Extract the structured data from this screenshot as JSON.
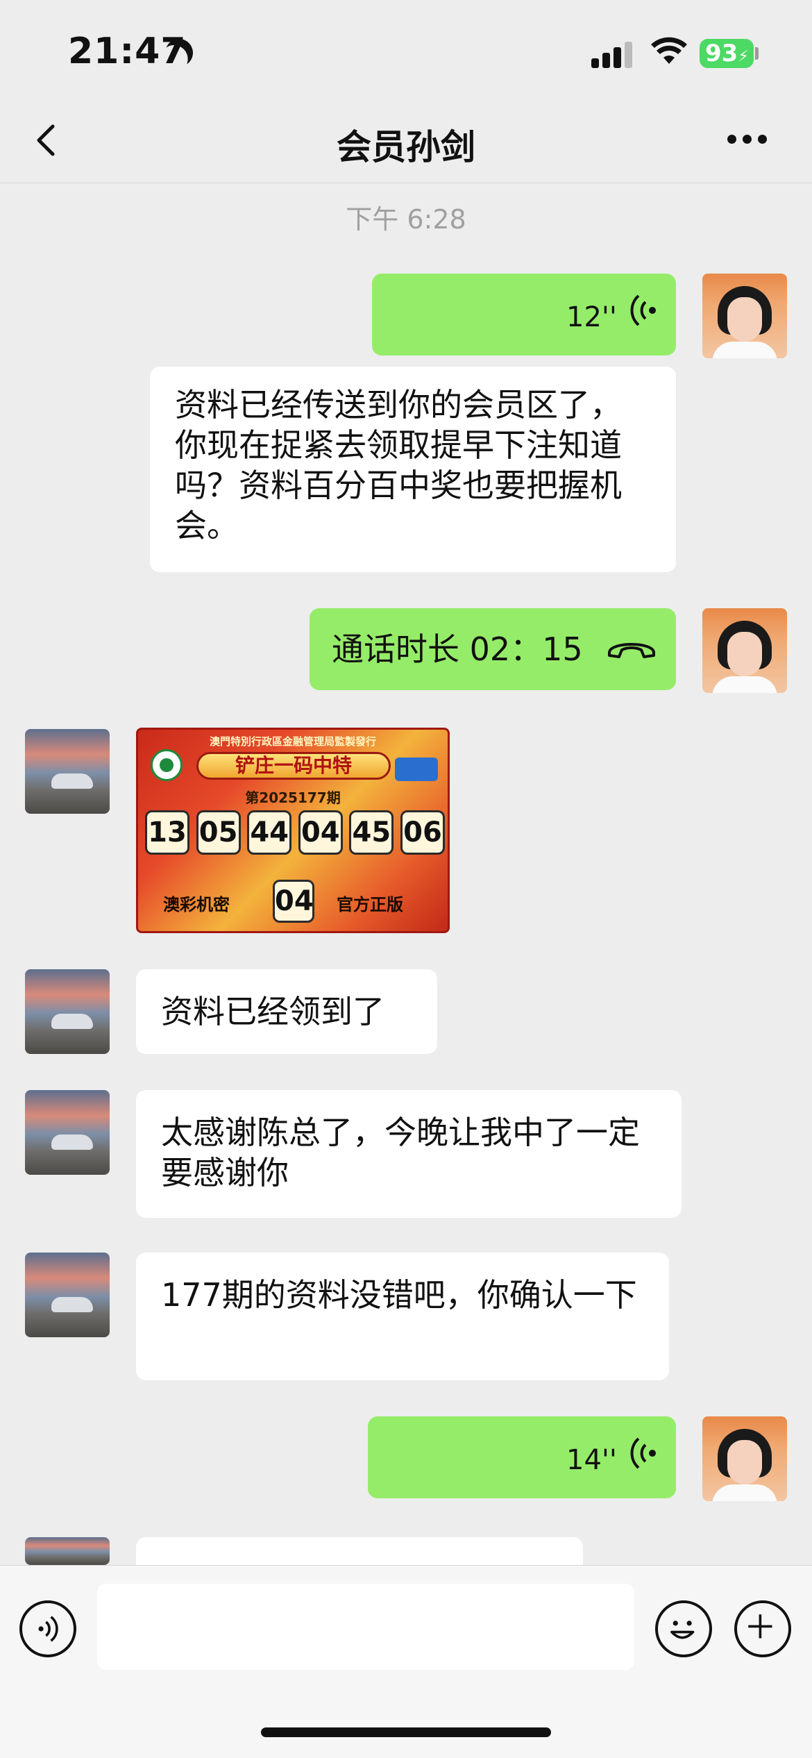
{
  "status_bar": {
    "time": "21:47",
    "battery": "93"
  },
  "nav": {
    "title": "会员孙剑"
  },
  "timestamp": "下午 6:28",
  "messages": [
    {
      "from": "self",
      "type": "voice",
      "duration": "12''"
    },
    {
      "from": "self",
      "type": "text",
      "text": "资料已经传送到你的会员区了，你现在捉紧去领取提早下注知道吗？资料百分百中奖也要把握机会。"
    },
    {
      "from": "self",
      "type": "call",
      "text": "通话时长 02：15"
    },
    {
      "from": "other",
      "type": "image",
      "card": {
        "header": "澳門特別行政區金融管理局監製發行",
        "title": "铲庄一码中特",
        "period": "第2025177期",
        "numbers": [
          "13",
          "05",
          "44",
          "04",
          "45",
          "06"
        ],
        "left_label": "澳彩机密",
        "special": "04",
        "right_label": "官方正版"
      }
    },
    {
      "from": "other",
      "type": "text",
      "text": "资料已经领到了"
    },
    {
      "from": "other",
      "type": "text",
      "text": "太感谢陈总了，今晚让我中了一定要感谢你"
    },
    {
      "from": "other",
      "type": "text",
      "text": "177期的资料没错吧，你确认一下"
    },
    {
      "from": "self",
      "type": "voice",
      "duration": "14''"
    }
  ],
  "colors": {
    "self_bubble": "#95ec69",
    "other_bubble": "#ffffff",
    "background": "#ededed"
  },
  "icons": [
    "back-icon",
    "more-icon",
    "voice-wave-icon",
    "hangup-icon",
    "voice-input-icon",
    "emoji-icon",
    "plus-icon"
  ]
}
